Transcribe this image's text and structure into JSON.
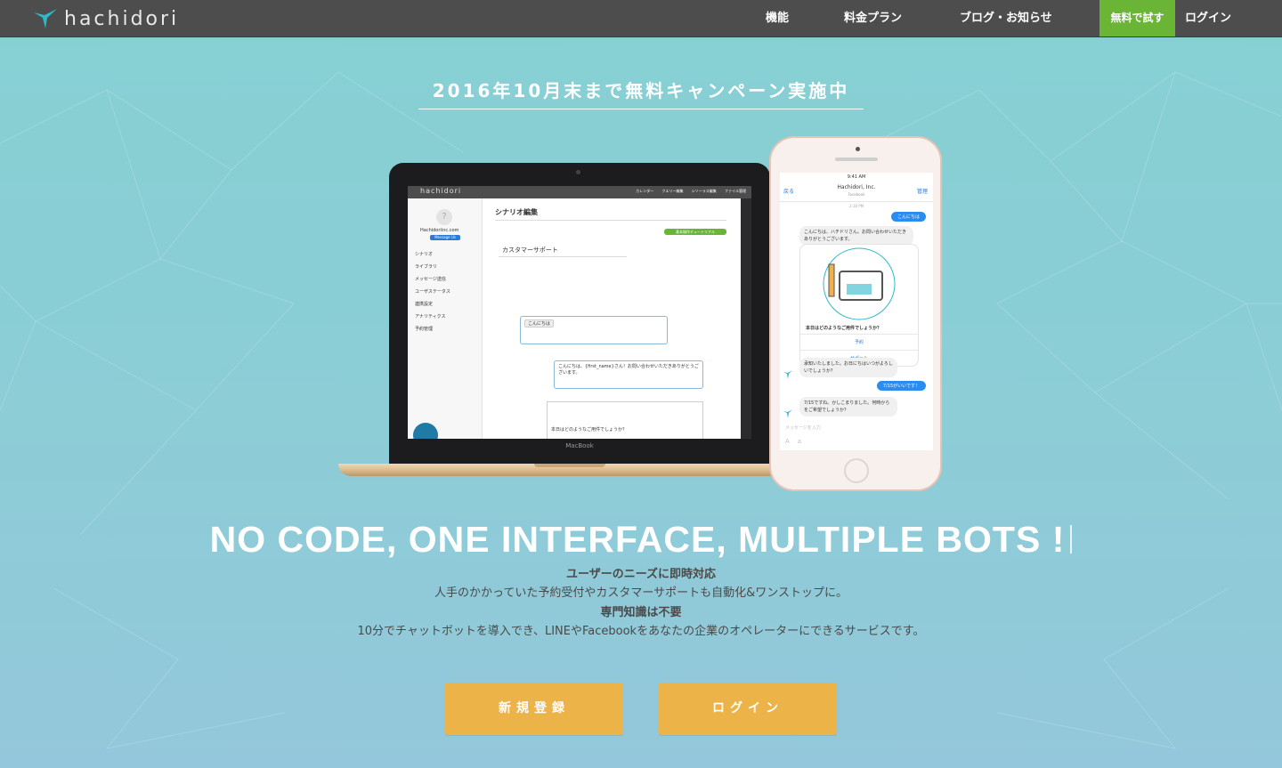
{
  "brand": {
    "name": "hachidori",
    "accent_green": "#6ab535",
    "button_orange": "#ecb349"
  },
  "nav": {
    "items": [
      "機能",
      "料金プラン",
      "ブログ・お知らせ"
    ],
    "cta": "無料で試す",
    "login": "ログイン"
  },
  "hero": {
    "campaign": "2016年10月末まで無料キャンペーン実施中",
    "headline": "NO CODE, ONE INTERFACE, MULTIPLE BOTS !",
    "sub1": "ユーザーのニーズに即時対応",
    "sub2": "人手のかかっていた予約受付やカスタマーサポートも自動化&ワンストップに。",
    "sub3": "専門知識は不要",
    "sub4": "10分でチャットボットを導入でき、LINEやFacebookをあなたの企業のオペレーターにできるサービスです。",
    "signup_button": "新規登録",
    "login_button": "ログイン"
  },
  "laptop": {
    "label": "MacBook",
    "logo": "hachidori",
    "nav": [
      "カレンダー",
      "クエリー編集",
      "シソーラス編集",
      "ファイル管理"
    ],
    "company": "Hachidoriinc.com",
    "message_button": "Message Us",
    "menu": [
      "シナリオ",
      "ライブラリ",
      "メッセージ送信",
      "ユーザステータス",
      "連携設定",
      "アナリティクス",
      "予約管理"
    ],
    "page_title": "シナリオ編集",
    "tutorial_button": "基本操作チュートリアル",
    "scenario_name": "カスタマーサポート",
    "user_tag": "こんにちは",
    "bot_reply": "こんにちは、{first_name}さん！お問い合わせいただきありがとうございます。",
    "question": "本日はどのようなご用件でしょうか？"
  },
  "phone": {
    "time": "9:41 AM",
    "back": "戻る",
    "page_name": "Hachidori, Inc.",
    "page_sub": "Facebook",
    "manage": "管理",
    "timestamp": "2:18 PM",
    "messages": {
      "user1": "こんにちは",
      "bot1": "こんにちは、ハチドリさん。お問い合わせいただきありがとうございます。",
      "card_question": "本日はどのようなご用件でしょうか？",
      "option1": "予約",
      "option2": "サポート",
      "bot2": "承知いたしました。お日にちはいつがよろしいでしょうか？",
      "user2": "7/15がいいです！",
      "bot3": "7/15ですね。かしこまりました。何時からをご希望でしょうか？"
    },
    "input_placeholder": "メッセージを入力",
    "input_icons": "Aa"
  }
}
